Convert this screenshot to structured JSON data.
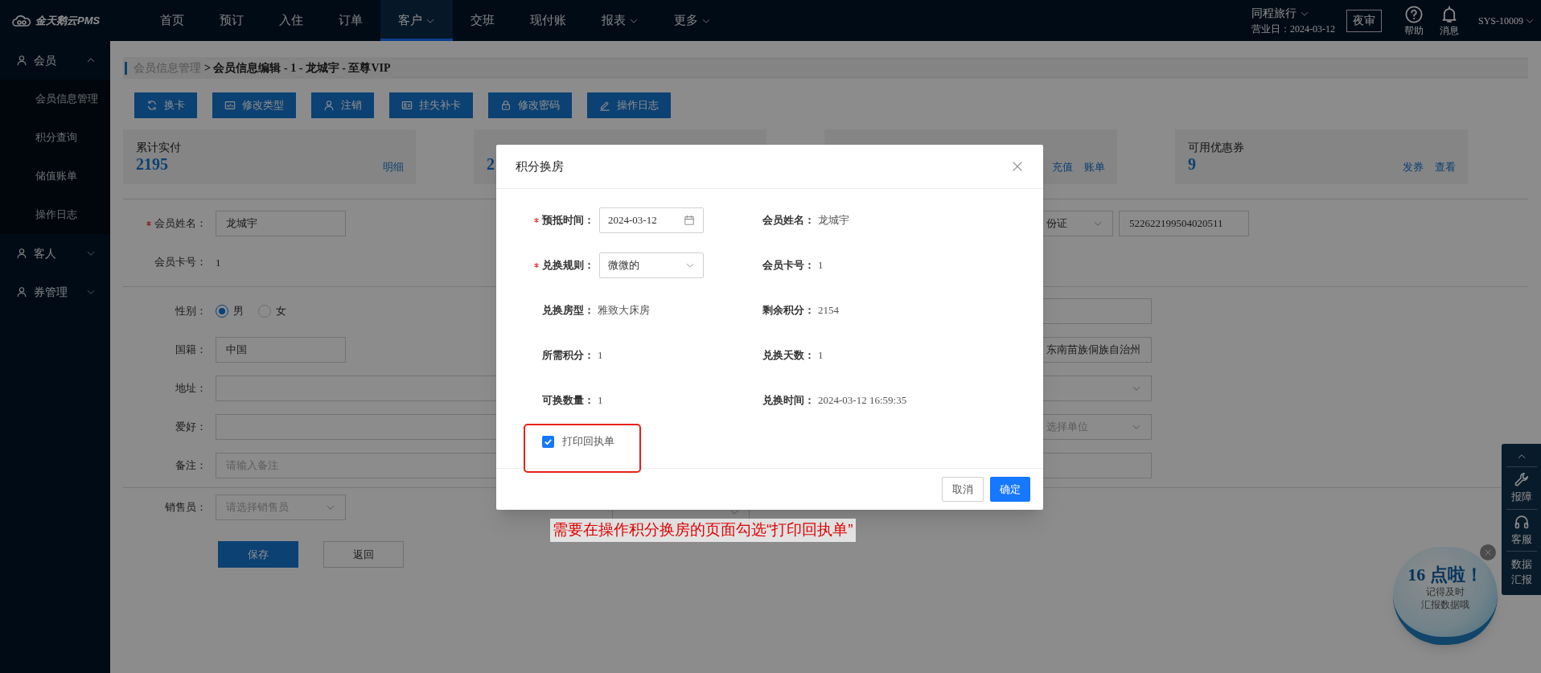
{
  "top_bar": {
    "logo": "金天鹅云PMS",
    "nav": [
      {
        "label": "首页",
        "selected": false,
        "dropdown": false
      },
      {
        "label": "预订",
        "selected": false,
        "dropdown": false
      },
      {
        "label": "入住",
        "selected": false,
        "dropdown": false
      },
      {
        "label": "订单",
        "selected": false,
        "dropdown": false
      },
      {
        "label": "客户",
        "selected": true,
        "dropdown": true
      },
      {
        "label": "交班",
        "selected": false,
        "dropdown": false
      },
      {
        "label": "现付账",
        "selected": false,
        "dropdown": false
      },
      {
        "label": "报表",
        "selected": false,
        "dropdown": true
      },
      {
        "label": "更多",
        "selected": false,
        "dropdown": true
      }
    ],
    "hotel": "同程旅行",
    "business_date": "营业日：2024-03-12",
    "night_audit": "夜审",
    "help": "帮助",
    "messages": "消息",
    "user": "SYS-10009"
  },
  "sidebar": {
    "groups": [
      {
        "label": "会员",
        "expanded": true,
        "children": [
          {
            "label": "会员信息管理"
          },
          {
            "label": "积分查询"
          },
          {
            "label": "储值账单"
          },
          {
            "label": "操作日志"
          }
        ]
      },
      {
        "label": "客人",
        "expanded": false
      },
      {
        "label": "券管理",
        "expanded": false
      }
    ]
  },
  "breadcrumb": {
    "parent": "会员信息管理",
    "current": "> 会员信息编辑 - 1 - 龙城宇 - 至尊VIP"
  },
  "actions": [
    {
      "label": "换卡",
      "kind": "refresh"
    },
    {
      "label": "修改类型",
      "kind": "card"
    },
    {
      "label": "注销",
      "kind": "user"
    },
    {
      "label": "挂失补卡",
      "kind": "idcard"
    },
    {
      "label": "修改密码",
      "kind": "lock"
    },
    {
      "label": "操作日志",
      "kind": "edit"
    }
  ],
  "cards": [
    {
      "title": "累计实付",
      "value": "2195",
      "links": [
        "明细"
      ]
    },
    {
      "value": "2"
    },
    {
      "links": [
        "充值",
        "账单"
      ]
    },
    {
      "title": "可用优惠券",
      "value": "9",
      "links": [
        "发券",
        "查看"
      ]
    }
  ],
  "form": {
    "sections": [
      [
        {
          "label": "会员姓名：",
          "required": true,
          "kind": "input",
          "value": "龙城宇",
          "right": {
            "kind": "id",
            "id_type": "份证",
            "value": "522622199504020511"
          }
        },
        {
          "label": "会员卡号：",
          "required": false,
          "kind": "text",
          "value": "1"
        }
      ],
      [
        {
          "label": "性别：",
          "required": false,
          "kind": "radio",
          "options": [
            {
              "label": "男",
              "selected": true
            },
            {
              "label": "女",
              "selected": false
            }
          ],
          "right": {
            "kind": "input"
          }
        },
        {
          "label": "国籍：",
          "required": false,
          "kind": "input",
          "value": "中国",
          "right": {
            "kind": "input",
            "value": "东南苗族侗族自治州"
          }
        },
        {
          "label": "地址：",
          "required": false,
          "kind": "wide",
          "right": {
            "kind": "select"
          }
        },
        {
          "label": "爱好：",
          "required": false,
          "kind": "wide",
          "right": {
            "kind": "select",
            "placeholder": "选择单位"
          }
        },
        {
          "label": "备注：",
          "required": false,
          "kind": "wide",
          "placeholder": "请输入备注",
          "right": {
            "kind": "input"
          }
        }
      ]
    ],
    "sales": {
      "label": "销售员：",
      "placeholder": "请选择销售员"
    },
    "buttons": [
      {
        "label": "保存",
        "kind": "primary"
      },
      {
        "label": "返回",
        "kind": "default"
      }
    ]
  },
  "modal": {
    "title": "积分换房",
    "fields": [
      {
        "label": "预抵时间：",
        "required": true,
        "kind": "date",
        "value": "2024-03-12"
      },
      {
        "label": "会员姓名：",
        "required": false,
        "kind": "text",
        "value": "龙城宇"
      },
      {
        "label": "兑换规则：",
        "required": true,
        "kind": "select",
        "value": "微微的"
      },
      {
        "label": "会员卡号：",
        "required": false,
        "kind": "text",
        "value": "1"
      },
      {
        "label": "兑换房型：",
        "required": false,
        "kind": "text",
        "value": "雅致大床房"
      },
      {
        "label": "剩余积分：",
        "required": false,
        "kind": "text",
        "value": "2154"
      },
      {
        "label": "所需积分：",
        "required": false,
        "kind": "text",
        "value": "1"
      },
      {
        "label": "兑换天数：",
        "required": false,
        "kind": "text",
        "value": "1"
      },
      {
        "label": "可换数量：",
        "required": false,
        "kind": "text",
        "value": "1"
      },
      {
        "label": "兑换时间：",
        "required": false,
        "kind": "text",
        "value": "2024-03-12 16:59:35"
      }
    ],
    "print_receipt": {
      "label": "打印回执单",
      "checked": true
    },
    "buttons": [
      {
        "label": "取消",
        "kind": "default"
      },
      {
        "label": "确定",
        "kind": "primary"
      }
    ]
  },
  "annotation": "需要在操作积分换房的页面勾选“打印回执单”",
  "float_panel": {
    "items": [
      {
        "kind": "top"
      },
      {
        "kind": "wrench",
        "label": "报障"
      },
      {
        "kind": "headset",
        "label": "客服"
      },
      {
        "kind": "text",
        "label": "数据汇报"
      }
    ]
  },
  "reminder": {
    "title": "16 点啦！",
    "lines": [
      "记得及时",
      "汇报数据哦"
    ]
  }
}
